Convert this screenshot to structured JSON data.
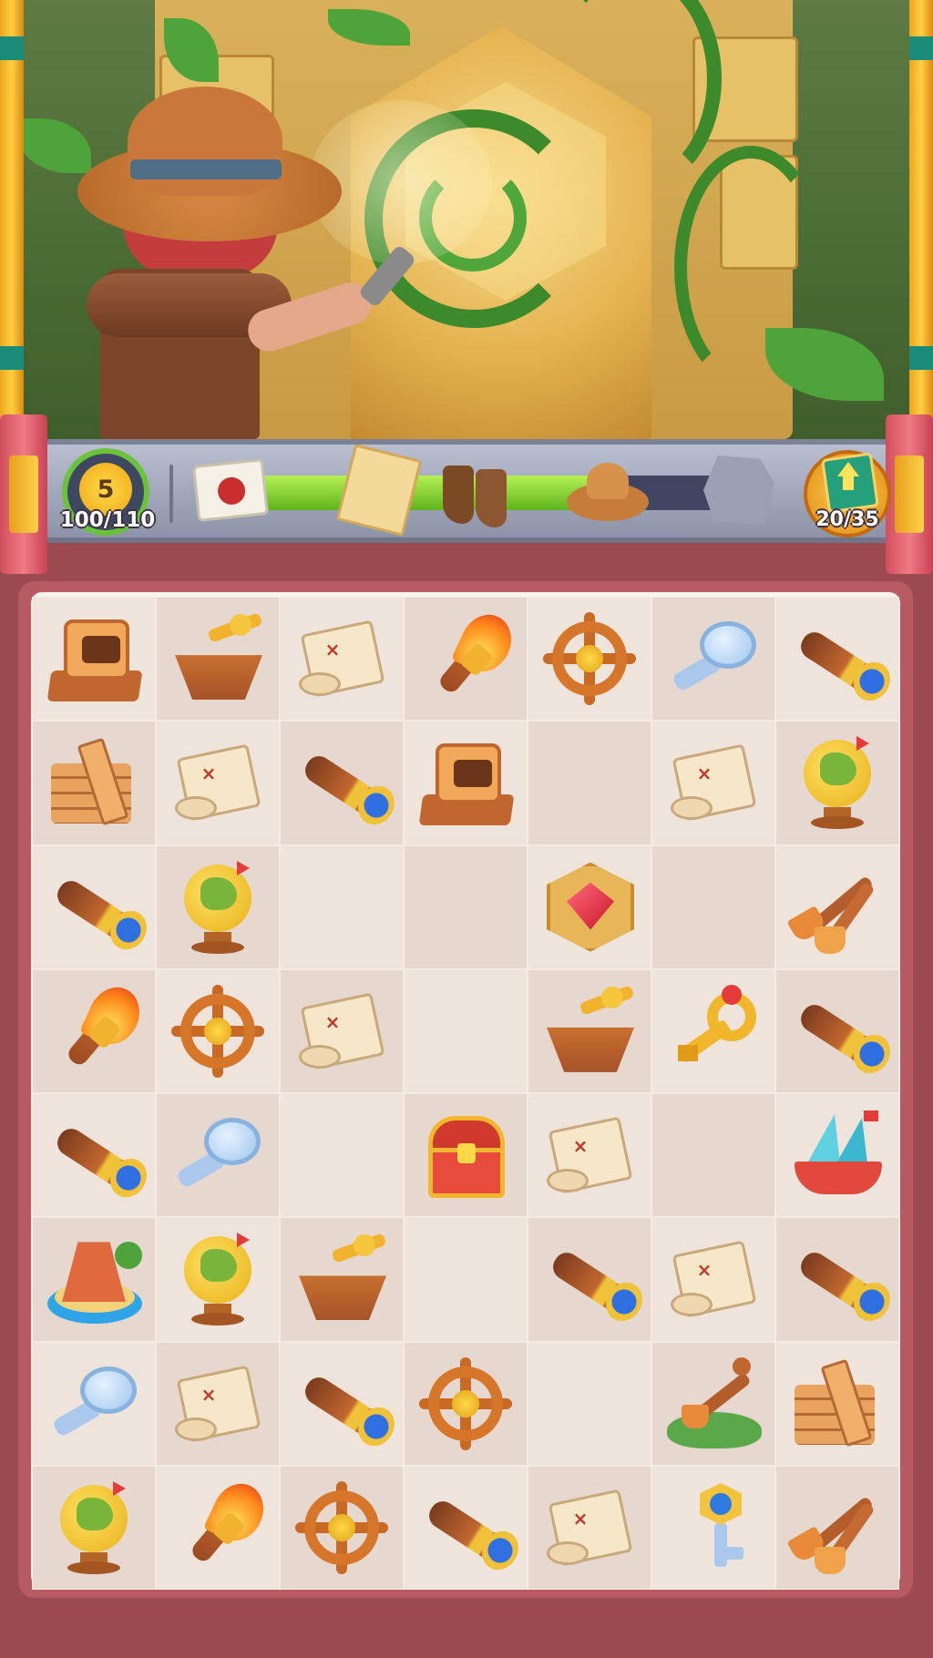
{
  "hud": {
    "level": "5",
    "xp": "100/110",
    "xp_progress": 0.909,
    "chest_progress": 0.81,
    "level_up_count": "20/35",
    "rewards": [
      "letter",
      "treasure-map",
      "boots",
      "explorer-hat",
      "locked-reward"
    ]
  },
  "board": {
    "columns": 7,
    "rows": [
      [
        "furnace",
        "sextant",
        "scroll",
        "torch",
        "wheel",
        "magnifier",
        "spyglass"
      ],
      [
        "bricks",
        "scroll",
        "spyglass",
        "furnace",
        "",
        "scroll",
        "globe"
      ],
      [
        "spyglass",
        "globe",
        "",
        "",
        "gem",
        "",
        "shovel"
      ],
      [
        "torch",
        "wheel",
        "scroll",
        "",
        "sextant",
        "goldkey",
        "spyglass"
      ],
      [
        "spyglass",
        "magnifier",
        "",
        "chest",
        "scroll",
        "",
        "ship"
      ],
      [
        "island",
        "globe",
        "sextant",
        "",
        "spyglass",
        "scroll",
        "spyglass"
      ],
      [
        "magnifier",
        "scroll",
        "spyglass",
        "wheel",
        "",
        "shovelgrass",
        "bricks"
      ],
      [
        "globe",
        "torch",
        "wheel",
        "spyglass",
        "scroll",
        "bluekey",
        "shovel"
      ]
    ]
  },
  "colors": {
    "board_bg": "#fbf4ec",
    "cell_light": "#efe4dc",
    "cell_dark": "#e6d8cf",
    "progress_fill": "#7fd02c",
    "frame": "#b85a61"
  }
}
